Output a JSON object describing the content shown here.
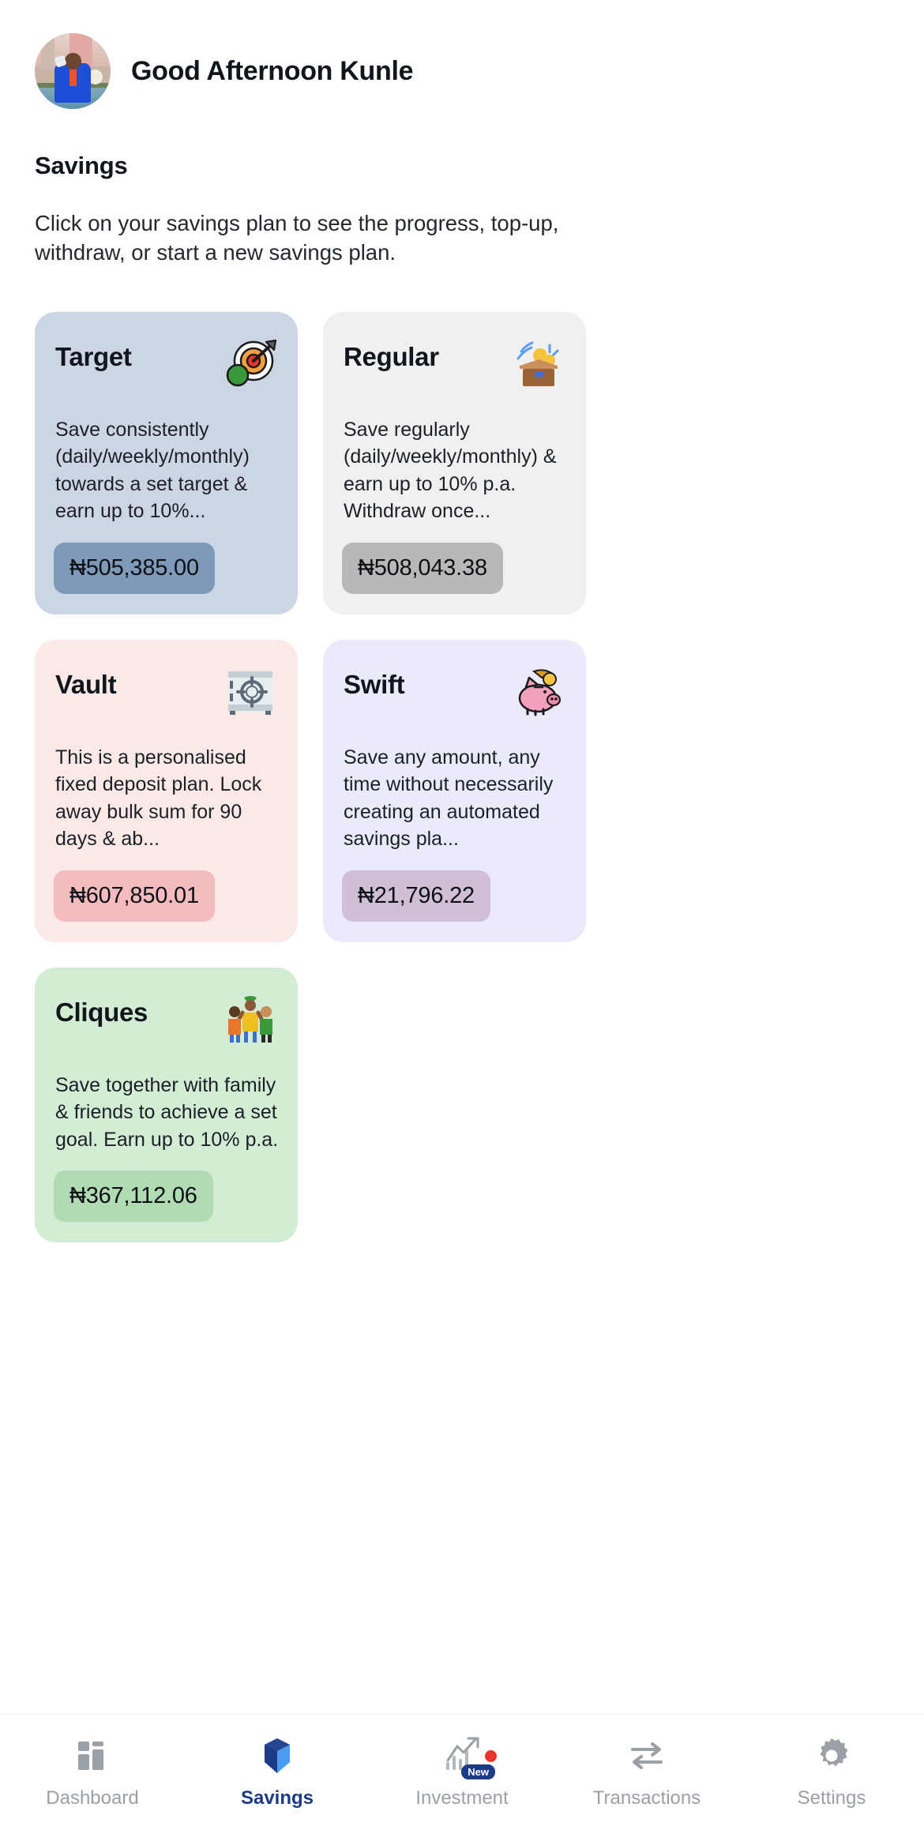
{
  "header": {
    "greeting": "Good Afternoon Kunle",
    "avatar_alt": "user-avatar"
  },
  "page": {
    "title": "Savings",
    "description": "Click on your savings plan to see the progress, top-up, withdraw, or start a new savings plan."
  },
  "colors": {
    "target_bg": "#ccd5e3",
    "target_badge": "#7e9ab8",
    "regular_bg": "#f0f0f0",
    "regular_badge": "#b8b8b8",
    "vault_bg": "#fae9e7",
    "vault_badge": "#f5bcc0",
    "swift_bg": "#ebeafa",
    "swift_badge": "#d1bfd6",
    "cliques_bg": "#d3edd4",
    "cliques_badge": "#b1dcb3",
    "active_nav": "#1b3b86",
    "inactive_nav": "#9aa0a6"
  },
  "plans": [
    {
      "title": "Target",
      "description": "Save consistently (daily/weekly/monthly) towards a set target & earn up to 10%...",
      "amount": "₦505,385.00",
      "icon": "dartboard-icon"
    },
    {
      "title": "Regular",
      "description": "Save regularly (daily/weekly/monthly) & earn up to 10% p.a. Withdraw once...",
      "amount": "₦508,043.38",
      "icon": "open-box-icon"
    },
    {
      "title": "Vault",
      "description": "This is a personalised fixed deposit plan. Lock away bulk sum for 90 days & ab...",
      "amount": "₦607,850.01",
      "icon": "safe-vault-icon"
    },
    {
      "title": "Swift",
      "description": "Save any amount, any time without necessarily creating an automated savings pla...",
      "amount": "₦21,796.22",
      "icon": "piggy-bank-icon"
    },
    {
      "title": "Cliques",
      "description": "Save together with family & friends to achieve a set goal. Earn up to 10% p.a.",
      "amount": "₦367,112.06",
      "icon": "people-celebrating-icon"
    }
  ],
  "bottom_nav": {
    "items": [
      {
        "label": "Dashboard",
        "icon": "dashboard-grid-icon",
        "active": false,
        "badge": ""
      },
      {
        "label": "Savings",
        "icon": "savings-cube-icon",
        "active": true,
        "badge": ""
      },
      {
        "label": "Investment",
        "icon": "growth-chart-icon",
        "active": false,
        "badge": "New"
      },
      {
        "label": "Transactions",
        "icon": "transfer-arrows-icon",
        "active": false,
        "badge": ""
      },
      {
        "label": "Settings",
        "icon": "gear-icon",
        "active": false,
        "badge": ""
      }
    ]
  }
}
